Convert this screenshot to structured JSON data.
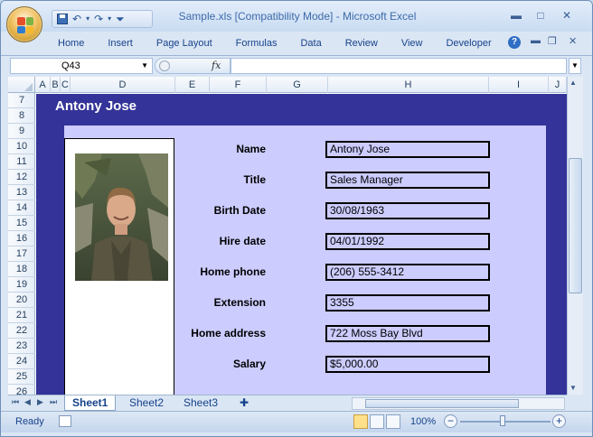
{
  "window": {
    "title": "Sample.xls  [Compatibility Mode] - Microsoft Excel",
    "minimize": "▬",
    "maximize": "□",
    "close": "✕"
  },
  "ribbon": {
    "tabs": [
      "Home",
      "Insert",
      "Page Layout",
      "Formulas",
      "Data",
      "Review",
      "View",
      "Developer"
    ],
    "help": "?"
  },
  "formula_bar": {
    "name_box": "Q43",
    "fx_label": "fx",
    "formula_value": ""
  },
  "columns": [
    "A",
    "B",
    "C",
    "D",
    "E",
    "F",
    "G",
    "H",
    "I",
    "J"
  ],
  "rows": [
    "7",
    "8",
    "9",
    "10",
    "11",
    "12",
    "13",
    "14",
    "15",
    "16",
    "17",
    "18",
    "19",
    "20",
    "21",
    "22",
    "23",
    "24",
    "25",
    "26"
  ],
  "employee": {
    "banner_name": "Antony Jose",
    "fields": [
      {
        "label": "Name",
        "value": "Antony Jose"
      },
      {
        "label": "Title",
        "value": "Sales Manager"
      },
      {
        "label": "Birth Date",
        "value": "30/08/1963"
      },
      {
        "label": "Hire date",
        "value": "04/01/1992"
      },
      {
        "label": "Home phone",
        "value": "(206) 555-3412"
      },
      {
        "label": "Extension",
        "value": "3355"
      },
      {
        "label": "Home address",
        "value": "722 Moss Bay Blvd"
      },
      {
        "label": "Salary",
        "value": "$5,000.00"
      }
    ]
  },
  "sheet_tabs": [
    "Sheet1",
    "Sheet2",
    "Sheet3"
  ],
  "active_sheet": "Sheet1",
  "status": {
    "ready": "Ready",
    "zoom": "100%"
  },
  "colors": {
    "banner": "#333399",
    "panel": "#ccccff"
  }
}
